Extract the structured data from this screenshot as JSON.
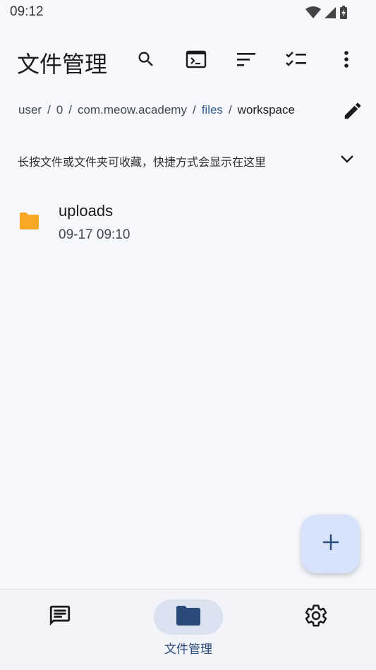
{
  "status_bar": {
    "time": "09:12",
    "icons": [
      "wifi-icon",
      "signal-icon",
      "battery-charging-icon"
    ]
  },
  "app_bar": {
    "title": "文件管理",
    "actions": [
      "search-icon",
      "terminal-icon",
      "sort-icon",
      "checklist-icon",
      "more-vert-icon"
    ]
  },
  "breadcrumb": {
    "segments": [
      "user",
      "0",
      "com.meow.academy",
      "files",
      "workspace"
    ],
    "separator": "/"
  },
  "bookmarks": {
    "hint": "长按文件或文件夹可收藏，快捷方式会显示在这里"
  },
  "files": [
    {
      "name": "uploads",
      "date": "09-17 09:10",
      "icon": "folder-icon"
    }
  ],
  "fab": {
    "icon": "add-icon"
  },
  "bottom_nav": {
    "items": [
      {
        "icon": "chat-icon",
        "label": ""
      },
      {
        "icon": "folder-icon",
        "label": "文件管理"
      },
      {
        "icon": "gear-icon",
        "label": ""
      }
    ]
  },
  "colors": {
    "background": "#f7f8fd",
    "accent": "#2a4a7a",
    "folder": "#f9a825",
    "fab": "#d7e3fb"
  }
}
